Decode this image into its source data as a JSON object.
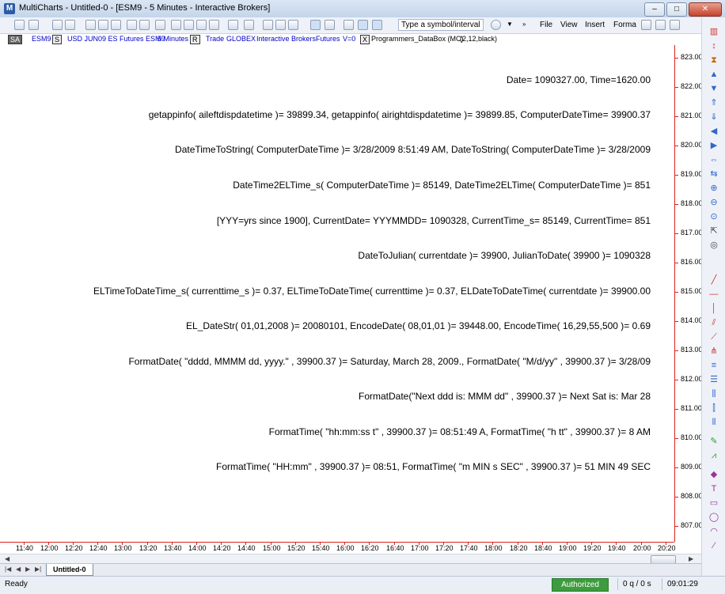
{
  "window": {
    "title": "MultiCharts - Untitled-0 - [ESM9 - 5 Minutes - Interactive Brokers]",
    "app_icon_letter": "M",
    "minimize": "–",
    "maximize": "□",
    "close": "✕"
  },
  "toolbar": {
    "symbol_placeholder": "Type a symbol/interval",
    "menu": [
      "File",
      "View",
      "Insert",
      "Forma"
    ]
  },
  "infoline": {
    "sa": "SA",
    "symbol": "ESM9",
    "s_tag": "S",
    "description": "USD JUN09 ES Futures ESM9",
    "interval": "5 Minutes",
    "r_tag": "R",
    "data_type": "Trade",
    "exchange": "GLOBEX",
    "source": "Interactive Brokers",
    "category": "Futures",
    "volume": "V=0",
    "x_tag": "X",
    "study": "Programmers_DataBox (MC)",
    "study_params": "(2,12,black)"
  },
  "databox_lines": [
    "Date= 1090327.00,     Time=1620.00",
    "getappinfo( aileftdispdatetime )= 39899.34,     getappinfo( airightdispdatetime )= 39899.85,     ComputerDateTime= 39900.37",
    "DateTimeToString( ComputerDateTime )= 3/28/2009 8:51:49 AM,     DateToString( ComputerDateTime )= 3/28/2009",
    "DateTime2ELTime_s( ComputerDateTime )= 85149,     DateTime2ELTime( ComputerDateTime )= 851",
    "[YYY=yrs since 1900], CurrentDate= YYYMMDD= 1090328,     CurrentTime_s= 85149,     CurrentTime= 851",
    "DateToJulian( currentdate )= 39900,     JulianToDate( 39900 )= 1090328",
    "ELTimeToDateTime_s( currenttime_s )=     0.37,     ELTimeToDateTime( currenttime )=     0.37,     ELDateToDateTime( currentdate )= 39900.00",
    "EL_DateStr( 01,01,2008 )= 20080101,     EncodeDate( 08,01,01 )= 39448.00,     EncodeTime( 16,29,55,500 )=     0.69",
    "FormatDate( \"dddd, MMMM dd, yyyy.\" , 39900.37 )= Saturday, March 28, 2009.,     FormatDate( \"M/d/yy\" , 39900.37 )= 3/28/09",
    "FormatDate(\"Next ddd is: MMM dd\" , 39900.37 )= Next Sat is: Mar 28",
    "FormatTime( \"hh:mm:ss t\" , 39900.37 )= 08:51:49 A,     FormatTime( \"h tt\" , 39900.37 )= 8 AM",
    "FormatTime( \"HH:mm\" , 39900.37 )= 08:51,     FormatTime( \"m MIN s SEC\" , 39900.37 )= 51 MIN 49 SEC"
  ],
  "price_axis": [
    "823.00",
    "822.00",
    "821.00",
    "820.00",
    "819.00",
    "818.00",
    "817.00",
    "816.00",
    "815.00",
    "814.00",
    "813.00",
    "812.00",
    "811.00",
    "810.00",
    "809.00",
    "808.00",
    "807.00"
  ],
  "time_axis": [
    "11:40",
    "12:00",
    "12:20",
    "12:40",
    "13:00",
    "13:20",
    "13:40",
    "14:00",
    "14:20",
    "14:40",
    "15:00",
    "15:20",
    "15:40",
    "16:00",
    "16:20",
    "16:40",
    "17:00",
    "17:20",
    "17:40",
    "18:00",
    "18:20",
    "18:40",
    "19:00",
    "19:20",
    "19:40",
    "20:00",
    "20:20"
  ],
  "sheet_tab": "Untitled-0",
  "status": {
    "ready": "Ready",
    "authorized": "Authorized",
    "queue": "0 q / 0 s",
    "clock": "09:01:29"
  },
  "colors": {
    "axis": "#e0201a",
    "info_text": "#0000c8",
    "authorized_bg": "#3d9c3d"
  }
}
